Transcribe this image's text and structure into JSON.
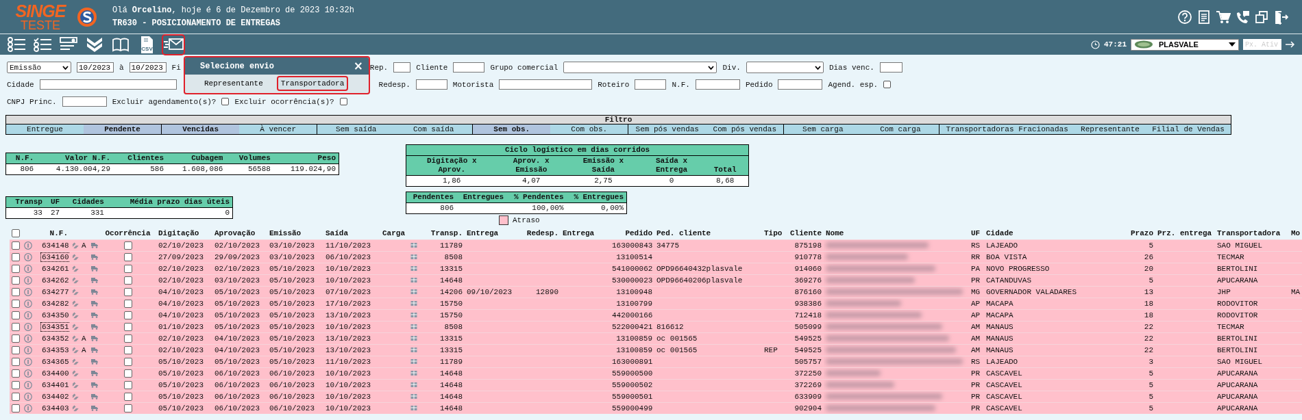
{
  "header": {
    "logo": {
      "line1": "SINGE",
      "line2": "TESTE"
    },
    "greeting": "Olá **Orcelino**, hoje é 6 de Dezembro de 2023 10:32h",
    "screen_title": "TR630 - POSICIONAMENTO DE ENTREGAS",
    "actions": [
      {
        "kind": "help"
      },
      {
        "kind": "document"
      },
      {
        "kind": "cart"
      },
      {
        "kind": "phone"
      },
      {
        "kind": "windows"
      },
      {
        "kind": "exit"
      }
    ]
  },
  "toolbar": {
    "tools": [
      {
        "kind": "list",
        "highlighted": false
      },
      {
        "kind": "checklist",
        "highlighted": false
      },
      {
        "kind": "form",
        "highlighted": false
      },
      {
        "kind": "chevrons",
        "highlighted": false
      },
      {
        "kind": "book",
        "highlighted": false
      },
      {
        "kind": "csv",
        "label": "CSV",
        "highlighted": false
      },
      {
        "kind": "mail",
        "highlighted": true
      }
    ],
    "timer": "47:21",
    "company": {
      "value": "PLASVALE"
    },
    "next_field": {
      "placeholder": "Px. Ativ."
    }
  },
  "form": {
    "rows": [
      [
        {
          "kind": "select",
          "value": "Emissão"
        },
        {
          "kind": "input",
          "value": "10/2023"
        },
        {
          "kind": "label",
          "text": "à"
        },
        {
          "kind": "input",
          "value": "10/2023"
        },
        {
          "kind": "label",
          "text": "Fi"
        },
        {
          "kind": "label",
          "text": "Rep."
        },
        {
          "kind": "input"
        },
        {
          "kind": "label",
          "text": "Cliente"
        },
        {
          "kind": "input"
        },
        {
          "kind": "label",
          "text": "Grupo comercial"
        },
        {
          "kind": "select"
        },
        {
          "kind": "label",
          "text": "Div."
        },
        {
          "kind": "select"
        },
        {
          "kind": "label",
          "text": "Dias venc."
        },
        {
          "kind": "input"
        }
      ],
      [
        {
          "kind": "label",
          "text": "Cidade"
        },
        {
          "kind": "input"
        },
        {
          "kind": "label",
          "text": "Redesp."
        },
        {
          "kind": "input"
        },
        {
          "kind": "label",
          "text": "Motorista"
        },
        {
          "kind": "input"
        },
        {
          "kind": "label",
          "text": "Roteiro"
        },
        {
          "kind": "input"
        },
        {
          "kind": "label",
          "text": "N.F."
        },
        {
          "kind": "input"
        },
        {
          "kind": "label",
          "text": "Pedido"
        },
        {
          "kind": "input"
        },
        {
          "kind": "label",
          "text": "Agend. esp."
        },
        {
          "kind": "checkbox",
          "checked": false
        }
      ],
      [
        {
          "kind": "label",
          "text": "CNPJ Princ."
        },
        {
          "kind": "input"
        },
        {
          "kind": "label",
          "text": "Excluir agendamento(s)?"
        },
        {
          "kind": "checkbox",
          "checked": false
        },
        {
          "kind": "label",
          "text": "Excluir ocorrência(s)?"
        },
        {
          "kind": "checkbox",
          "checked": false
        }
      ]
    ]
  },
  "send_dialog": {
    "title": "Selecione envio",
    "close": "×",
    "options": [
      {
        "label": "Representante",
        "highlighted": false
      },
      {
        "label": "Transportadora",
        "highlighted": true
      }
    ]
  },
  "filter_bar": {
    "title": "Filtro",
    "groups": [
      {
        "options": [
          {
            "label": "Entregue",
            "selected": false
          },
          {
            "label": "Pendente",
            "selected": true
          }
        ]
      },
      {
        "options": [
          {
            "label": "Vencidas",
            "selected": true
          },
          {
            "label": "À vencer",
            "selected": false
          }
        ]
      },
      {
        "options": [
          {
            "label": "Sem saída",
            "selected": false
          },
          {
            "label": "Com saída",
            "selected": false
          }
        ]
      },
      {
        "options": [
          {
            "label": "Sem obs.",
            "selected": true
          },
          {
            "label": "Com obs.",
            "selected": false
          }
        ]
      },
      {
        "options": [
          {
            "label": "Sem pós vendas",
            "selected": false
          },
          {
            "label": "Com pós vendas",
            "selected": false
          }
        ]
      },
      {
        "options": [
          {
            "label": "Sem carga",
            "selected": false
          },
          {
            "label": "Com carga",
            "selected": false
          }
        ]
      },
      {
        "options": [
          {
            "label": "Transportadoras Fracionadas",
            "selected": false
          },
          {
            "label": "Representante",
            "selected": false
          },
          {
            "label": "Filial de Vendas",
            "selected": false
          }
        ]
      }
    ]
  },
  "totals": {
    "columns": [
      "N.F.",
      "Valor N.F.",
      "Clientes",
      "Cubagem",
      "Volumes",
      "Peso"
    ],
    "values": [
      "806",
      "4.130.004,29",
      "586",
      "1.608,086",
      "56588",
      "119.024,90"
    ]
  },
  "transport_summary": {
    "columns": [
      "Transp",
      "UF",
      "Cidades",
      "Média prazo dias úteis"
    ],
    "values": [
      "33",
      "27",
      "331",
      "0"
    ]
  },
  "logistics_cycle": {
    "title": "Ciclo logístico em dias corridos",
    "columns": [
      [
        "Digitação x",
        "Aprov."
      ],
      [
        "Aprov. x",
        "Emissão"
      ],
      [
        "Emissão x",
        "Saída"
      ],
      [
        "Saída x",
        "Entrega"
      ],
      [
        "Total"
      ]
    ],
    "values": [
      "1,86",
      "4,07",
      "2,75",
      "0",
      "8,68"
    ]
  },
  "delivery_status": {
    "cells": [
      {
        "label": "Pendentes",
        "value": "806"
      },
      {
        "label": "Entregues"
      },
      {
        "label": "% Pendentes",
        "value": "100,00%"
      },
      {
        "label": "% Entregues",
        "value": "0,00%"
      }
    ]
  },
  "legend": [
    {
      "label": "Atraso",
      "color": "#ffc0cb"
    }
  ],
  "table": {
    "select_all": {
      "checked": false
    },
    "columns": [
      "N.F.",
      "Ocorrência",
      "Digitação",
      "Aprovação",
      "Emissão",
      "Saída",
      "Carga",
      "Transp.",
      "Entrega",
      "Redesp.",
      "Entrega",
      "Pedido",
      "Ped. cliente",
      "Tipo",
      "Cliente",
      "Nome",
      "UF",
      "Cidade",
      "Prazo",
      "Prz. entrega",
      "Transportadora",
      "Mo"
    ],
    "rows": [
      {
        "selected": false,
        "nf": "634148",
        "outlined": false,
        "flag": "A",
        "occurrence": false,
        "late": true,
        "digitacao": "02/10/2023",
        "aprovacao": "02/10/2023",
        "emissao": "03/10/2023",
        "saida": "11/10/2023",
        "transp": "11789",
        "pedido": "163000843",
        "ped_cliente": "34775",
        "cliente": "875198",
        "uf": "RS",
        "cidade": "LAJEADO",
        "prazo": "5",
        "transportadora": "SAO MIGUEL"
      },
      {
        "selected": false,
        "nf": "634160",
        "outlined": true,
        "occurrence": false,
        "late": true,
        "digitacao": "27/09/2023",
        "aprovacao": "29/09/2023",
        "emissao": "03/10/2023",
        "saida": "06/10/2023",
        "transp": "8508",
        "pedido": "13100514",
        "cliente": "910778",
        "uf": "RR",
        "cidade": "BOA VISTA",
        "prazo": "26",
        "transportadora": "TECMAR"
      },
      {
        "selected": false,
        "nf": "634261",
        "outlined": false,
        "occurrence": false,
        "late": true,
        "digitacao": "02/10/2023",
        "aprovacao": "02/10/2023",
        "emissao": "05/10/2023",
        "saida": "10/10/2023",
        "transp": "13315",
        "pedido": "541000062",
        "ped_cliente": "OPD96640432plasvale",
        "cliente": "914060",
        "uf": "PA",
        "cidade": "NOVO PROGRESSO",
        "prazo": "20",
        "transportadora": "BERTOLINI"
      },
      {
        "selected": false,
        "nf": "634262",
        "outlined": false,
        "occurrence": false,
        "late": true,
        "digitacao": "02/10/2023",
        "aprovacao": "03/10/2023",
        "emissao": "05/10/2023",
        "saida": "10/10/2023",
        "transp": "14648",
        "pedido": "530000023",
        "ped_cliente": "OPD96640206plasvale",
        "cliente": "369276",
        "uf": "PR",
        "cidade": "CATANDUVAS",
        "prazo": "5",
        "transportadora": "APUCARANA"
      },
      {
        "selected": false,
        "nf": "634277",
        "outlined": false,
        "occurrence": false,
        "late": true,
        "digitacao": "04/10/2023",
        "aprovacao": "05/10/2023",
        "emissao": "05/10/2023",
        "saida": "07/10/2023",
        "transp": "14206",
        "entrega": "09/10/2023",
        "redesp": "12890",
        "pedido": "13100948",
        "cliente": "876160",
        "uf": "MG",
        "cidade": "GOVERNADOR VALADARES",
        "prazo": "13",
        "transportadora": "JHP",
        "column_26": "MA"
      },
      {
        "selected": false,
        "nf": "634282",
        "outlined": false,
        "occurrence": false,
        "late": true,
        "digitacao": "04/10/2023",
        "aprovacao": "05/10/2023",
        "emissao": "05/10/2023",
        "saida": "17/10/2023",
        "transp": "15750",
        "pedido": "13100799",
        "cliente": "938386",
        "uf": "AP",
        "cidade": "MACAPA",
        "prazo": "18",
        "transportadora": "RODOVITOR"
      },
      {
        "selected": false,
        "nf": "634350",
        "outlined": false,
        "occurrence": false,
        "late": true,
        "digitacao": "04/10/2023",
        "aprovacao": "05/10/2023",
        "emissao": "05/10/2023",
        "saida": "13/10/2023",
        "transp": "15750",
        "pedido": "442000166",
        "cliente": "712418",
        "uf": "AP",
        "cidade": "MACAPA",
        "prazo": "18",
        "transportadora": "RODOVITOR"
      },
      {
        "selected": false,
        "nf": "634351",
        "outlined": true,
        "occurrence": false,
        "late": true,
        "digitacao": "01/10/2023",
        "aprovacao": "05/10/2023",
        "emissao": "05/10/2023",
        "saida": "10/10/2023",
        "transp": "8508",
        "pedido": "522000421",
        "ped_cliente": "816612",
        "cliente": "505099",
        "uf": "AM",
        "cidade": "MANAUS",
        "prazo": "22",
        "transportadora": "TECMAR"
      },
      {
        "selected": false,
        "nf": "634352",
        "outlined": false,
        "flag": "A",
        "occurrence": false,
        "late": true,
        "digitacao": "02/10/2023",
        "aprovacao": "04/10/2023",
        "emissao": "05/10/2023",
        "saida": "13/10/2023",
        "transp": "13315",
        "pedido": "13100859",
        "ped_cliente": "oc 001565",
        "cliente": "549525",
        "uf": "AM",
        "cidade": "MANAUS",
        "prazo": "22",
        "transportadora": "BERTOLINI"
      },
      {
        "selected": false,
        "nf": "634353",
        "outlined": false,
        "flag": "A",
        "occurrence": false,
        "late": true,
        "digitacao": "02/10/2023",
        "aprovacao": "04/10/2023",
        "emissao": "05/10/2023",
        "saida": "13/10/2023",
        "transp": "13315",
        "pedido": "13100859",
        "ped_cliente": "oc 001565",
        "tipo": "REP",
        "cliente": "549525",
        "uf": "AM",
        "cidade": "MANAUS",
        "prazo": "22",
        "transportadora": "BERTOLINI"
      },
      {
        "selected": false,
        "nf": "634365",
        "outlined": false,
        "occurrence": false,
        "late": true,
        "digitacao": "05/10/2023",
        "aprovacao": "05/10/2023",
        "emissao": "05/10/2023",
        "saida": "11/10/2023",
        "transp": "11789",
        "pedido": "163000891",
        "cliente": "505757",
        "uf": "RS",
        "cidade": "LAJEADO",
        "prazo": "3",
        "transportadora": "SAO MIGUEL"
      },
      {
        "selected": false,
        "nf": "634400",
        "outlined": false,
        "occurrence": false,
        "late": true,
        "digitacao": "05/10/2023",
        "aprovacao": "06/10/2023",
        "emissao": "06/10/2023",
        "saida": "10/10/2023",
        "transp": "14648",
        "pedido": "559000500",
        "cliente": "372250",
        "uf": "PR",
        "cidade": "CASCAVEL",
        "prazo": "5",
        "transportadora": "APUCARANA"
      },
      {
        "selected": false,
        "nf": "634401",
        "outlined": false,
        "occurrence": false,
        "late": true,
        "digitacao": "05/10/2023",
        "aprovacao": "06/10/2023",
        "emissao": "06/10/2023",
        "saida": "10/10/2023",
        "transp": "14648",
        "pedido": "559000502",
        "cliente": "372269",
        "uf": "PR",
        "cidade": "CASCAVEL",
        "prazo": "5",
        "transportadora": "APUCARANA"
      },
      {
        "selected": false,
        "nf": "634402",
        "outlined": false,
        "occurrence": false,
        "late": true,
        "digitacao": "05/10/2023",
        "aprovacao": "06/10/2023",
        "emissao": "06/10/2023",
        "saida": "10/10/2023",
        "transp": "14648",
        "pedido": "559000501",
        "cliente": "633909",
        "uf": "PR",
        "cidade": "CASCAVEL",
        "prazo": "5",
        "transportadora": "APUCARANA"
      },
      {
        "selected": false,
        "nf": "634403",
        "outlined": false,
        "occurrence": false,
        "late": true,
        "digitacao": "05/10/2023",
        "aprovacao": "06/10/2023",
        "emissao": "06/10/2023",
        "saida": "10/10/2023",
        "transp": "14648",
        "pedido": "559000499",
        "cliente": "902904",
        "uf": "PR",
        "cidade": "CASCAVEL",
        "prazo": "5",
        "transportadora": "APUCARANA"
      }
    ]
  }
}
